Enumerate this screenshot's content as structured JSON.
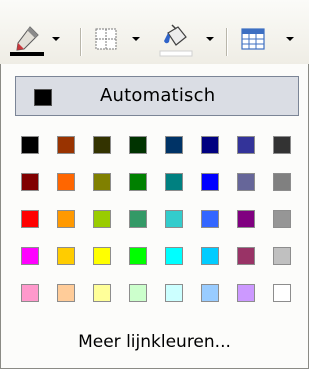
{
  "toolbar": {
    "buttons": [
      {
        "icon": "line-color-pen-icon",
        "current_color": "#000000"
      },
      {
        "icon": "borders-grid-icon"
      },
      {
        "icon": "fill-bucket-icon",
        "current_color": "#ffffff"
      },
      {
        "icon": "table-icon"
      }
    ]
  },
  "popup": {
    "automatic_label": "Automatisch",
    "automatic_color": "#000000",
    "more_colors_label": "Meer lijnkleuren...",
    "palette": [
      [
        "#000000",
        "#993300",
        "#333300",
        "#003300",
        "#003366",
        "#000080",
        "#333399",
        "#333333"
      ],
      [
        "#800000",
        "#ff6600",
        "#808000",
        "#008000",
        "#008080",
        "#0000ff",
        "#666699",
        "#808080"
      ],
      [
        "#ff0000",
        "#ff9900",
        "#99cc00",
        "#339966",
        "#33cccc",
        "#3366ff",
        "#800080",
        "#969696"
      ],
      [
        "#ff00ff",
        "#ffcc00",
        "#ffff00",
        "#00ff00",
        "#00ffff",
        "#00ccff",
        "#993366",
        "#c0c0c0"
      ],
      [
        "#ff99cc",
        "#ffcc99",
        "#ffff99",
        "#ccffcc",
        "#ccffff",
        "#99ccff",
        "#cc99ff",
        "#ffffff"
      ]
    ]
  }
}
